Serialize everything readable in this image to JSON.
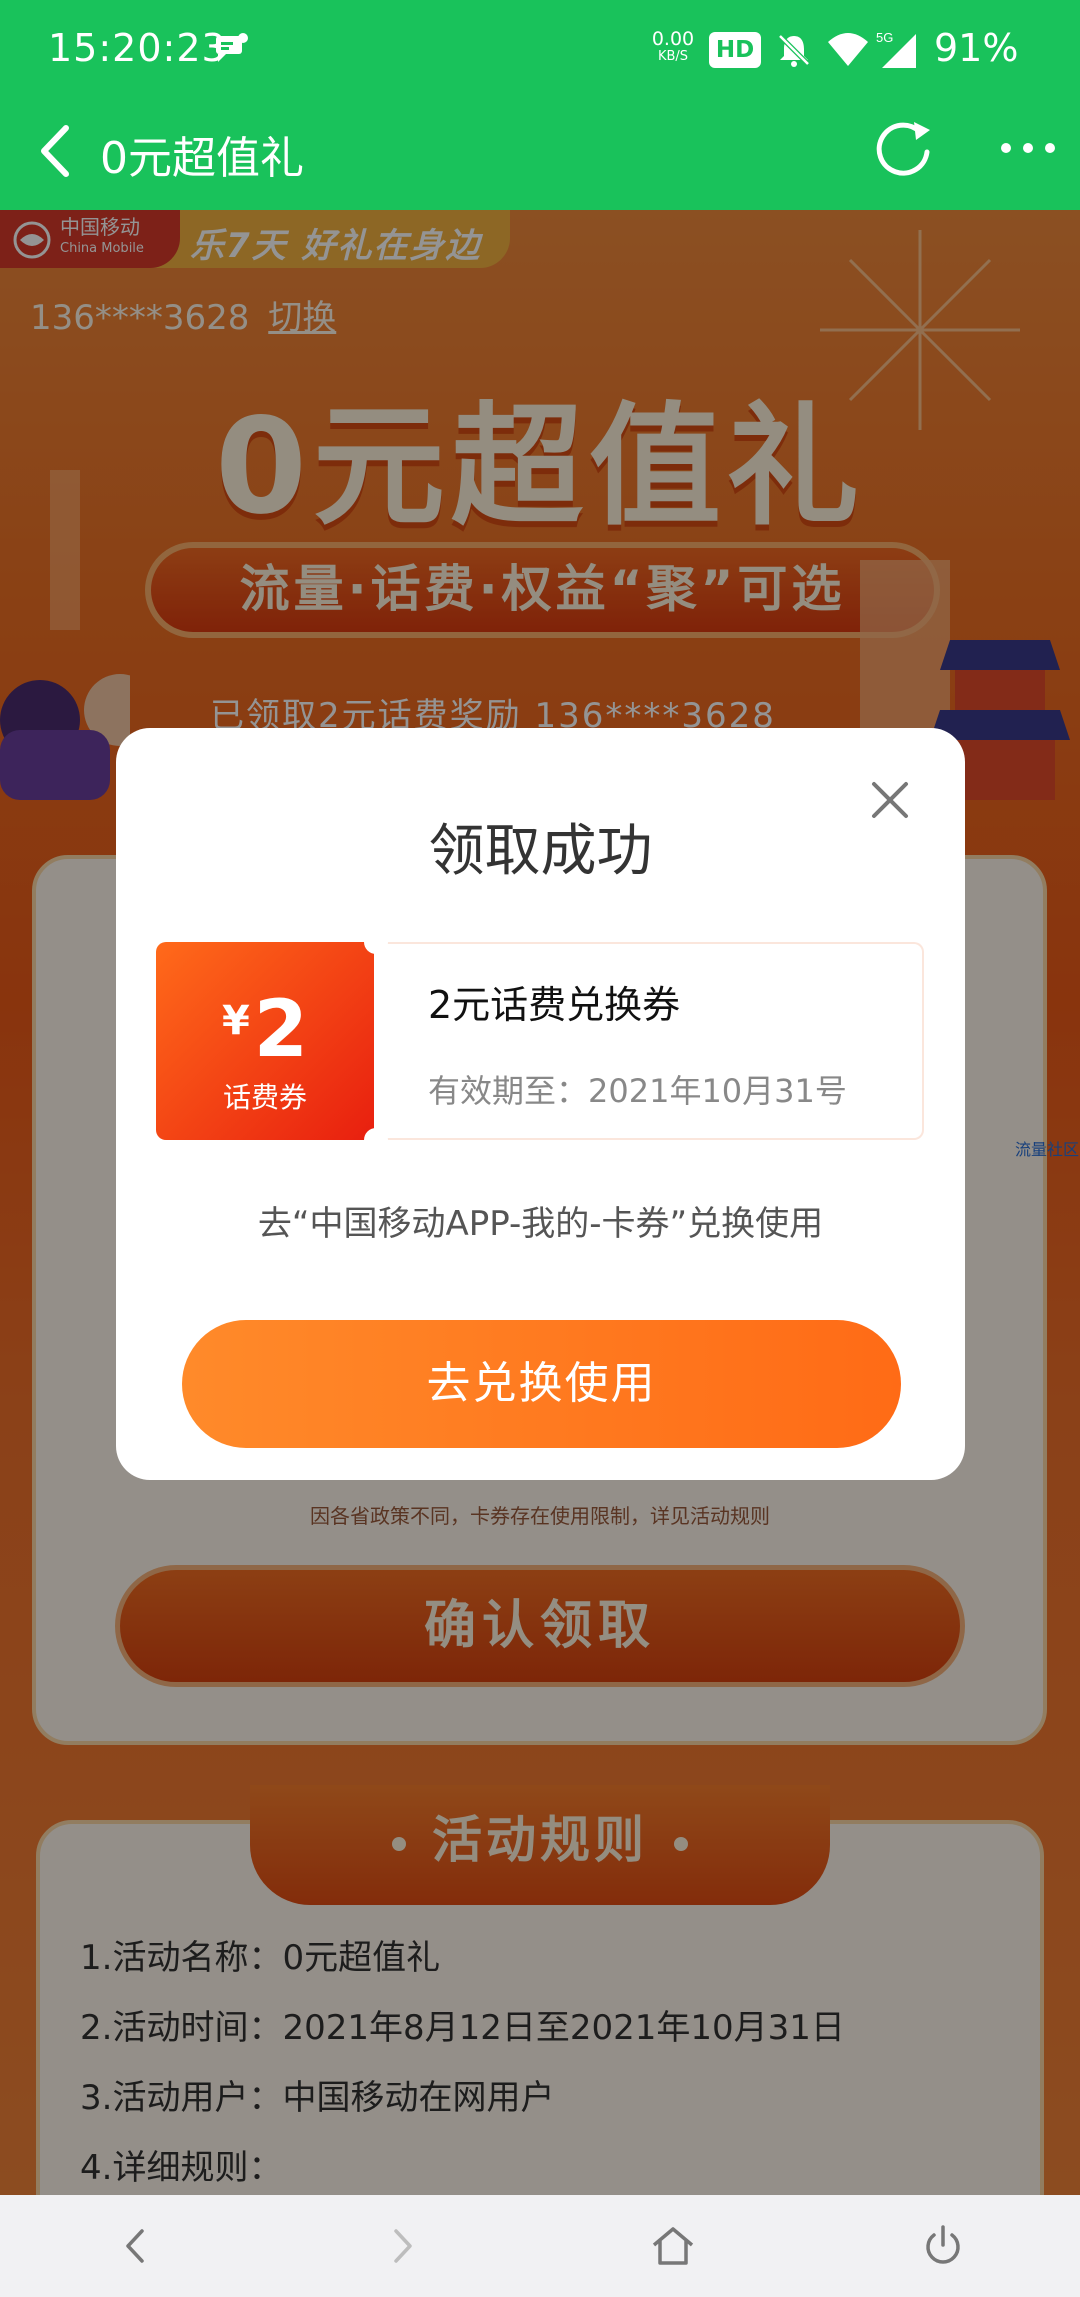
{
  "status_bar": {
    "time": "15:20:23",
    "net_speed": "0.00",
    "net_unit": "KB/S",
    "hd_label": "HD",
    "network_type": "5G",
    "battery": "91%"
  },
  "app_bar": {
    "title": "0元超值礼"
  },
  "background_page": {
    "brand_name": "中国移动",
    "brand_name_en": "China Mobile",
    "slogan": "乐7天 好礼在身边",
    "phone": "136****3628",
    "switch_label": "切换",
    "hero_title": "0元超值礼",
    "hero_banner": "流量·话费·权益“聚”可选",
    "behind_line": "已领取2元话费奖励 136****3628",
    "notice": "因各省政策不同，卡券存在使用限制，详见活动规则",
    "confirm_button": "确认领取",
    "side_label": "流量社区",
    "rules_title": "活动规则",
    "rules": [
      "1.活动名称：0元超值礼",
      "2.活动时间：2021年8月12日至2021年10月31日",
      "3.活动用户：中国移动在网用户",
      "4.详细规则："
    ]
  },
  "modal": {
    "heading": "领取成功",
    "coupon": {
      "currency": "¥",
      "amount": "2",
      "kind": "话费券",
      "name": "2元话费兑换券",
      "valid_until": "有效期至：2021年10月31号"
    },
    "hint": "去“中国移动APP-我的-卡券”兑换使用",
    "redeem_button": "去兑换使用"
  },
  "colors": {
    "app_green": "#19c25b",
    "accent_orange": "#ff7a1f",
    "coupon_red": "#e81f0f"
  }
}
